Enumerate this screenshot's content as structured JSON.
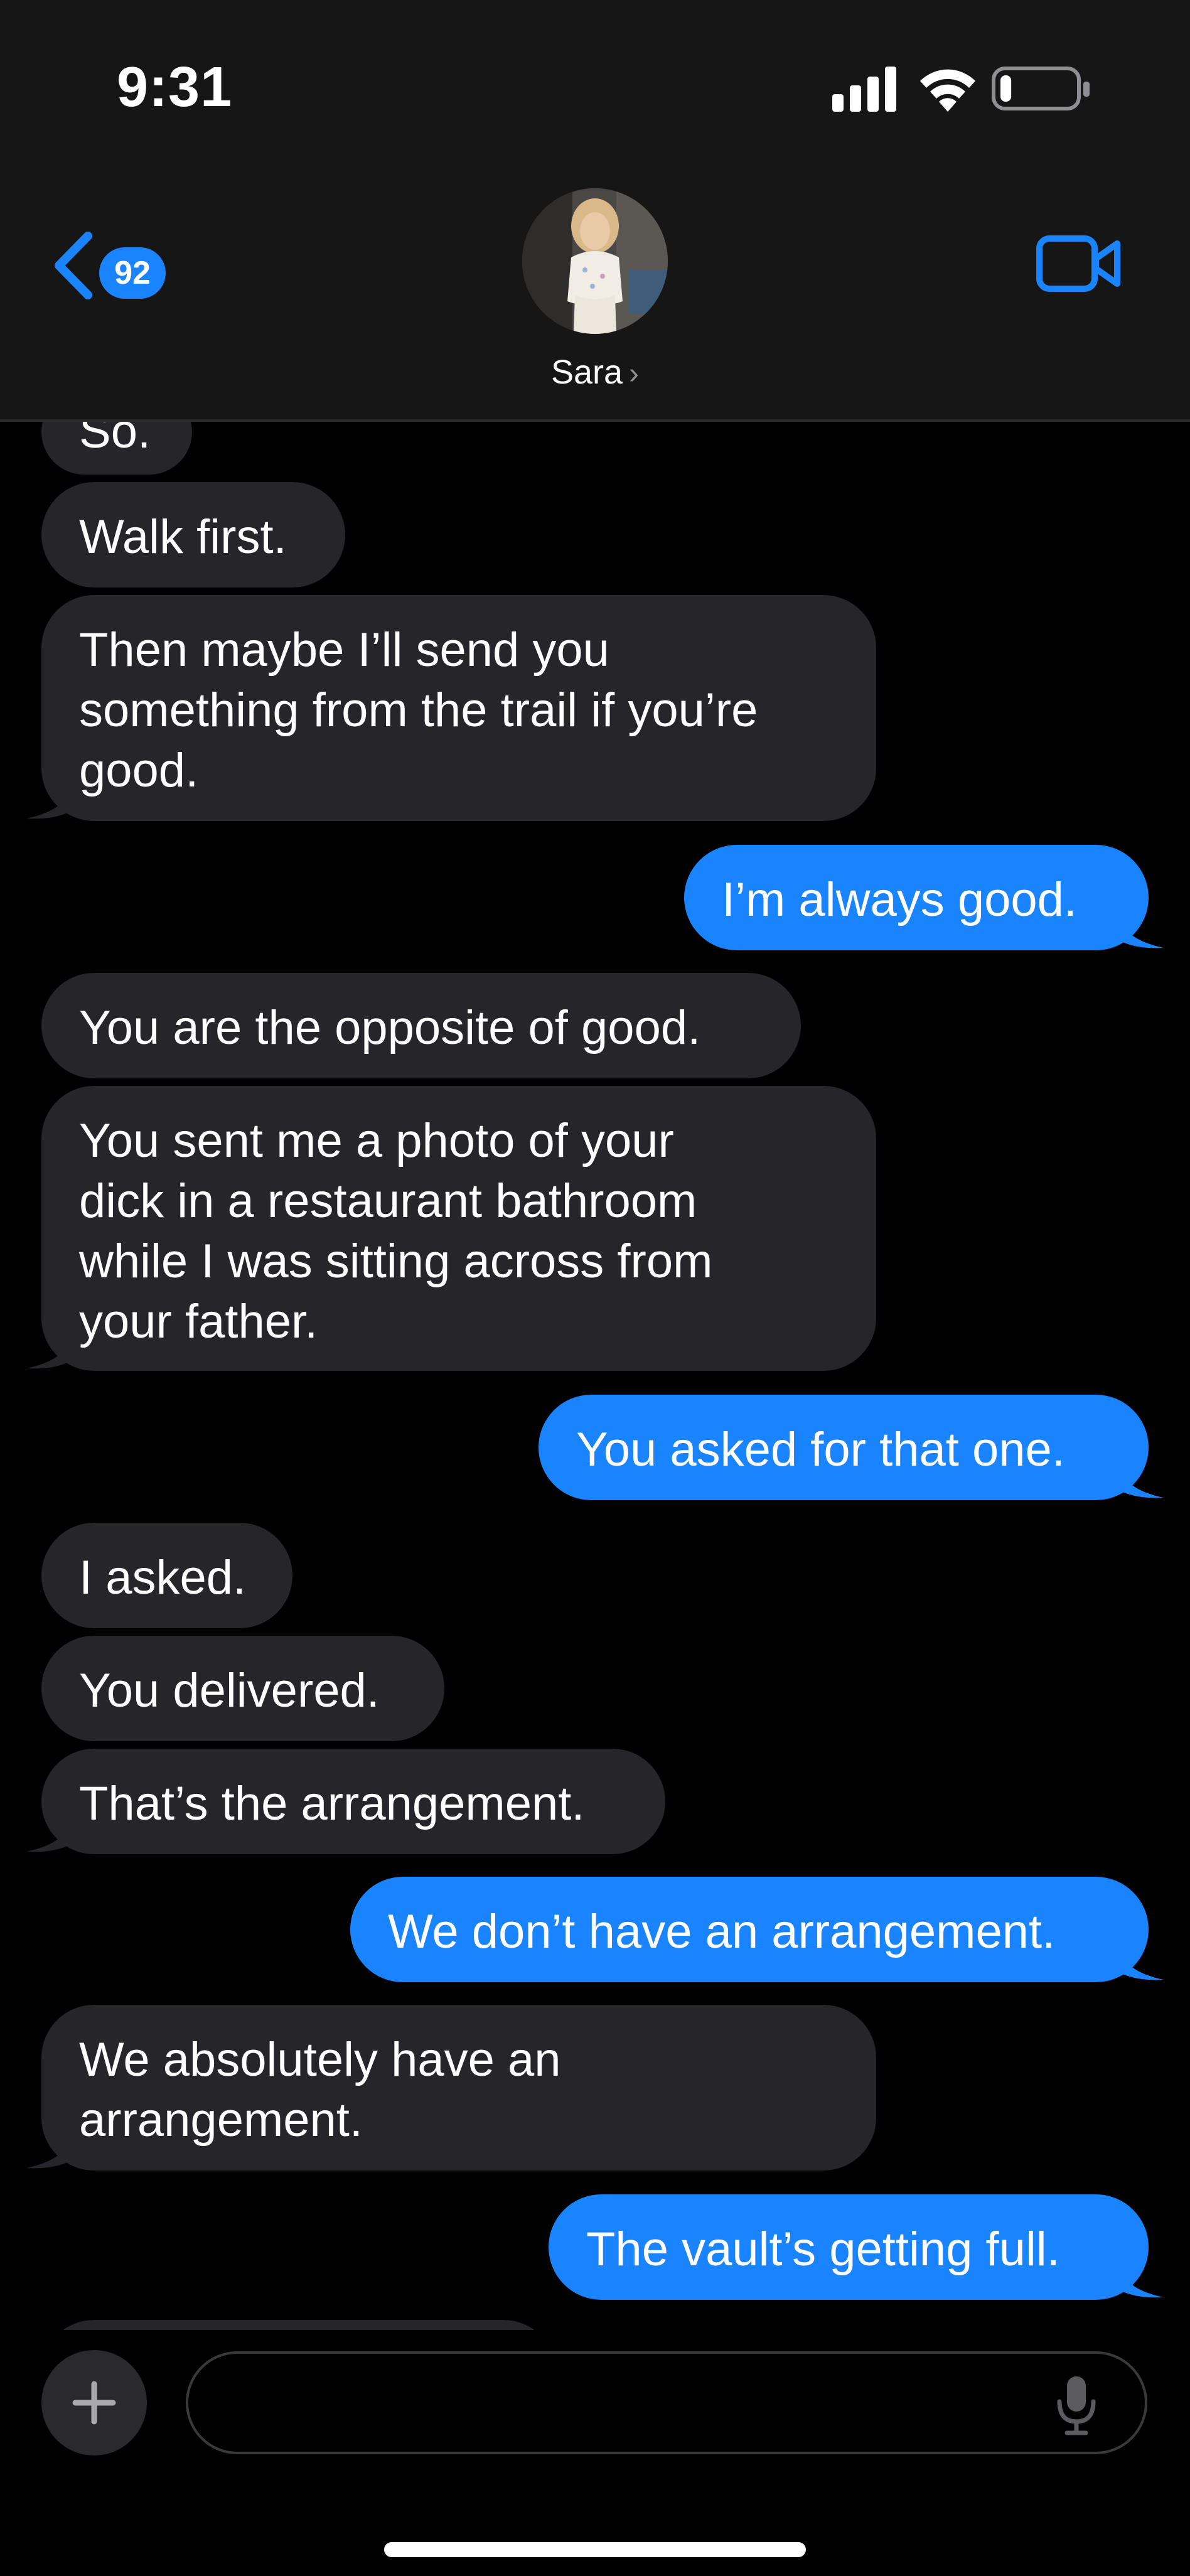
{
  "status_bar": {
    "time": "9:31",
    "icons": [
      "cellular-signal-icon",
      "wifi-icon",
      "battery-icon"
    ],
    "battery_level": 0.15
  },
  "header": {
    "back_badge": "92",
    "contact_name": "Sara",
    "name_chevron": "›",
    "icons": [
      "back-chevron-icon",
      "avatar",
      "video-call-icon"
    ]
  },
  "colors": {
    "outgoing_bubble": "#1a84ff",
    "incoming_bubble": "#26252a",
    "accent": "#1a84ff",
    "background": "#000000"
  },
  "messages": [
    {
      "from": "them",
      "lines": [
        "So."
      ]
    },
    {
      "from": "them",
      "lines": [
        "Walk first."
      ]
    },
    {
      "from": "them",
      "lines": [
        "Then maybe I’ll send you",
        "something from the trail if you’re",
        "good."
      ]
    },
    {
      "from": "me",
      "lines": [
        "I’m always good."
      ]
    },
    {
      "from": "them",
      "lines": [
        "You are the opposite of good."
      ]
    },
    {
      "from": "them",
      "lines": [
        "You sent me a photo of your",
        "dick in a restaurant bathroom",
        "while I was sitting across from",
        "your father."
      ]
    },
    {
      "from": "me",
      "lines": [
        "You asked for that one."
      ]
    },
    {
      "from": "them",
      "lines": [
        "I asked."
      ]
    },
    {
      "from": "them",
      "lines": [
        "You delivered."
      ]
    },
    {
      "from": "them",
      "lines": [
        "That’s the arrangement."
      ]
    },
    {
      "from": "me",
      "lines": [
        "We don’t have an arrangement."
      ]
    },
    {
      "from": "them",
      "lines": [
        "We absolutely have an",
        "arrangement."
      ]
    },
    {
      "from": "me",
      "lines": [
        "The vault’s getting full."
      ]
    }
  ],
  "compose": {
    "placeholder": "",
    "value": "",
    "icons": [
      "plus-icon",
      "microphone-icon"
    ]
  }
}
